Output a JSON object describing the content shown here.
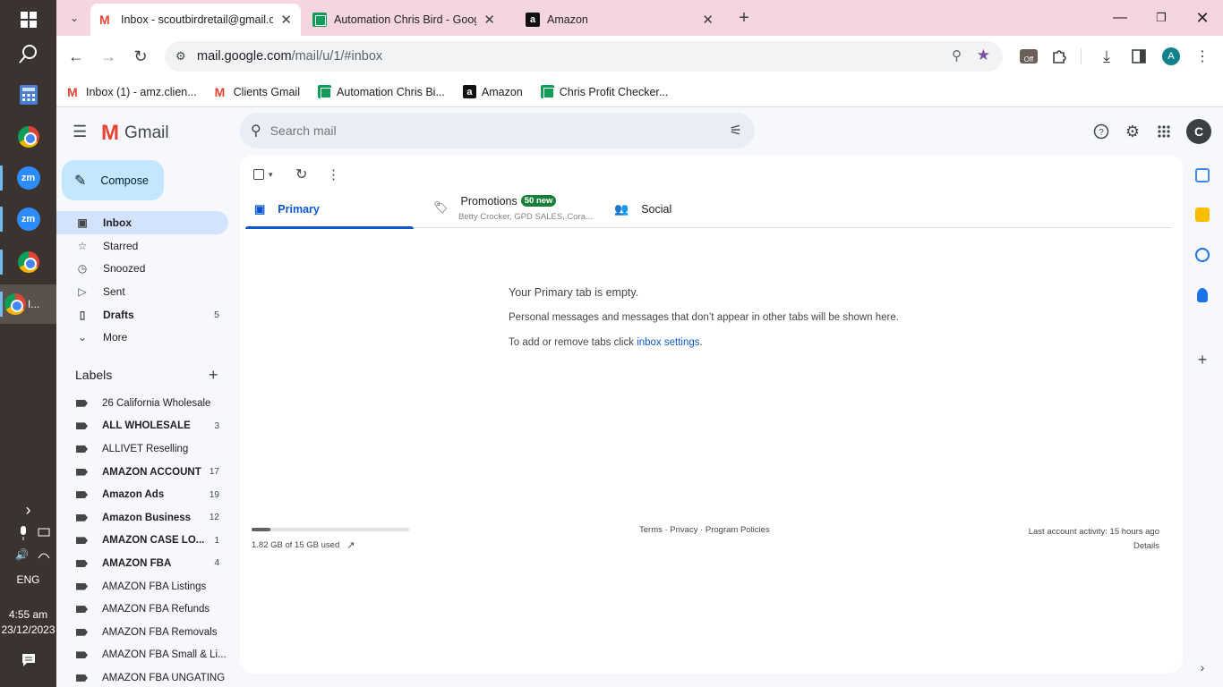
{
  "taskbar": {
    "zoom1": "zm",
    "zoom2": "zm",
    "active_label": "I...",
    "chevron": "›",
    "language": "ENG",
    "time": "4:55 am",
    "date": "23/12/2023"
  },
  "browser": {
    "tabs": [
      {
        "title": "Inbox - scoutbirdretail@gmail.com",
        "icon": "gmail-icon"
      },
      {
        "title": "Automation Chris Bird - Google",
        "icon": "sheets-icon"
      },
      {
        "title": "Amazon",
        "icon": "amazon-icon"
      }
    ],
    "url_host": "mail.google.com",
    "url_path": "/mail/u/1/#inbox",
    "profile_initial": "A",
    "extension_badge": "Off",
    "bookmarks": [
      {
        "label": "Inbox (1) - amz.clien...",
        "icon": "gmail-icon"
      },
      {
        "label": "Clients Gmail",
        "icon": "gmail-icon"
      },
      {
        "label": "Automation Chris Bi...",
        "icon": "sheets-icon"
      },
      {
        "label": "Amazon",
        "icon": "amazon-icon"
      },
      {
        "label": "Chris Profit Checker...",
        "icon": "sheets-icon"
      }
    ]
  },
  "gmail": {
    "logo_text": "Gmail",
    "search_placeholder": "Search mail",
    "avatar_initial": "C",
    "compose_label": "Compose",
    "nav": [
      {
        "label": "Inbox",
        "count": "",
        "icon": "inbox-icon"
      },
      {
        "label": "Starred",
        "count": "",
        "icon": "star-icon"
      },
      {
        "label": "Snoozed",
        "count": "",
        "icon": "clock-icon"
      },
      {
        "label": "Sent",
        "count": "",
        "icon": "send-icon"
      },
      {
        "label": "Drafts",
        "count": "5",
        "icon": "draft-icon"
      },
      {
        "label": "More",
        "count": "",
        "icon": "chevron-down-icon"
      }
    ],
    "labels_title": "Labels",
    "labels": [
      {
        "label": "26 California Wholesale",
        "count": ""
      },
      {
        "label": "ALL WHOLESALE",
        "count": "3"
      },
      {
        "label": "ALLIVET Reselling",
        "count": ""
      },
      {
        "label": "AMAZON ACCOUNT",
        "count": "17"
      },
      {
        "label": "Amazon Ads",
        "count": "19"
      },
      {
        "label": "Amazon Business",
        "count": "12"
      },
      {
        "label": "AMAZON CASE LO...",
        "count": "1"
      },
      {
        "label": "AMAZON FBA",
        "count": "4"
      },
      {
        "label": "AMAZON FBA Listings",
        "count": ""
      },
      {
        "label": "AMAZON FBA Refunds",
        "count": ""
      },
      {
        "label": "AMAZON FBA Removals",
        "count": ""
      },
      {
        "label": "AMAZON FBA Small & Li...",
        "count": ""
      },
      {
        "label": "AMAZON FBA UNGATING",
        "count": ""
      }
    ],
    "tabs": {
      "primary": "Primary",
      "promotions": "Promotions",
      "promotions_badge": "50 new",
      "promotions_senders": "Betty Crocker, GPD SALES, Cora...",
      "social": "Social"
    },
    "empty": {
      "title": "Your Primary tab is empty.",
      "line1": "Personal messages and messages that don’t appear in other tabs will be shown here.",
      "line2_prefix": "To add or remove tabs click ",
      "line2_link": "inbox settings",
      "line2_suffix": "."
    },
    "storage": {
      "text": "1.82 GB of 15 GB used",
      "fraction": 0.121
    },
    "footer_links": "Terms · Privacy · Program Policies",
    "activity": "Last account activity: 15 hours ago",
    "details": "Details"
  }
}
